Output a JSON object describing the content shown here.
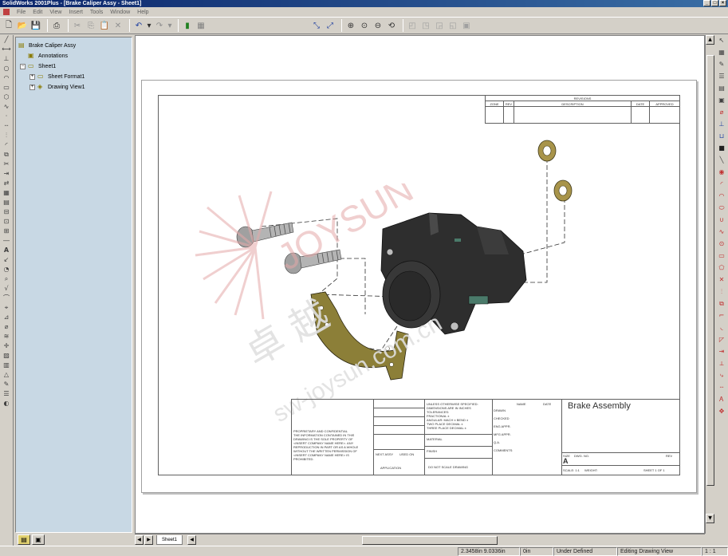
{
  "window": {
    "title": "SolidWorks 2001Plus - [Brake Caliper Assy - Sheet1]"
  },
  "menu": [
    "File",
    "Edit",
    "View",
    "Insert",
    "Tools",
    "Window",
    "Help"
  ],
  "tree": {
    "items": [
      {
        "label": "Brake Caliper Assy",
        "icon": "assembly-icon"
      },
      {
        "label": "Annotations",
        "icon": "annotations-icon"
      },
      {
        "label": "Sheet1",
        "icon": "sheet-icon"
      },
      {
        "label": "Sheet Format1",
        "icon": "sheet-format-icon"
      },
      {
        "label": "Drawing View1",
        "icon": "drawing-view-icon"
      }
    ]
  },
  "drawing": {
    "title": "Brake Assembly",
    "revisions": {
      "header": "REVISIONS",
      "cols": [
        "ZONE",
        "REV",
        "DESCRIPTION",
        "DATE",
        "APPROVED"
      ]
    },
    "title_block": {
      "dims_note": [
        "UNLESS OTHERWISE SPECIFIED:",
        "DIMENSIONS ARE IN INCHES",
        "TOLERANCES:",
        "FRACTIONAL ±",
        "ANGULAR: MACH ± BEND ±",
        "TWO PLACE DECIMAL ±",
        "THREE PLACE DECIMAL ±"
      ],
      "proprietary": [
        "PROPRIETARY AND CONFIDENTIAL",
        "THE INFORMATION CONTAINED IN THIS",
        "DRAWING IS THE SOLE PROPERTY OF",
        "<INSERT COMPANY NAME HERE>. ANY",
        "REPRODUCTION IN PART OR AS A WHOLE",
        "WITHOUT THE WRITTEN PERMISSION OF",
        "<INSERT COMPANY NAME HERE> IS",
        "PROHIBITED."
      ],
      "material": "MATERIAL",
      "finish": "FINISH",
      "next_assy": "NEXT ASSY",
      "used_on": "USED ON",
      "application": "APPLICATION",
      "do_not_scale": "DO NOT SCALE DRAWING",
      "name_col": "NAME",
      "date_col": "DATE",
      "roles": [
        "DRAWN",
        "CHECKED",
        "ENG APPR.",
        "MFG APPR.",
        "Q.A.",
        "COMMENTS:"
      ],
      "size_label": "SIZE",
      "size": "A",
      "dwg_no_label": "DWG. NO.",
      "rev_label": "REV",
      "scale": "SCALE: 1:1",
      "weight": "WEIGHT:",
      "sheet": "SHEET 1 OF 1"
    }
  },
  "watermark": {
    "brand": "JOYSUN",
    "cn": "卓 越",
    "url": "sw-joysun.com.cn"
  },
  "sheet_tab": "Sheet1",
  "status": {
    "coords": "2.3458in 9.0336in",
    "z": "0in",
    "state": "Under Defined",
    "mode": "Editing Drawing View",
    "scale": "1 : 1"
  },
  "colors": {
    "tree_bg": "#c8d8e4",
    "bracket": "#8c7f38",
    "caliper": "#2e2e2e",
    "washer": "#a8944a"
  }
}
